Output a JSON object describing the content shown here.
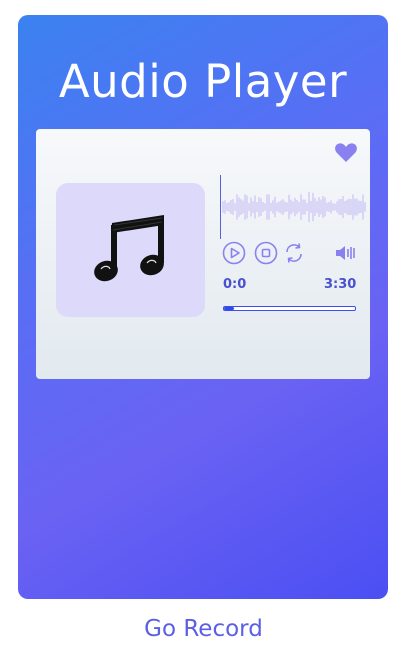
{
  "app": {
    "title": "Audio Player"
  },
  "player": {
    "time_current": "0:0",
    "time_total": "3:30",
    "progress_fraction": 0.08,
    "icons": {
      "favorite": "heart-icon",
      "album": "music-note-icon",
      "play": "play-icon",
      "stop": "stop-icon",
      "repeat": "repeat-icon",
      "volume": "volume-icon"
    }
  },
  "footer": {
    "link_label": "Go Record"
  },
  "colors": {
    "accent": "#5b5fe4",
    "icon_purple": "#8a80f0",
    "album_bg": "#dcd9fb",
    "progress": "#3048ee"
  }
}
